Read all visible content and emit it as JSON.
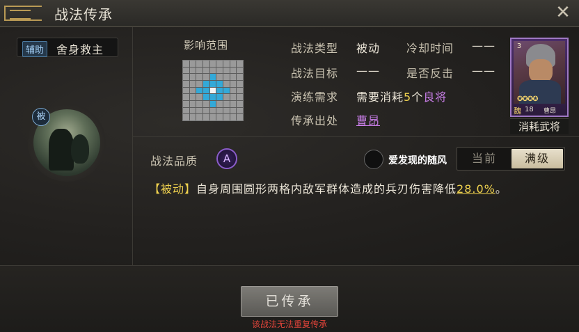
{
  "window": {
    "title": "战法传承",
    "close_label": "✕"
  },
  "skill": {
    "type_tag": "辅助",
    "name": "舍身救主",
    "passive_badge": "被"
  },
  "range": {
    "label": "影响范围",
    "grid_size": 9,
    "hit_cells": [
      [
        3,
        4
      ],
      [
        4,
        3
      ],
      [
        4,
        5
      ],
      [
        5,
        4
      ],
      [
        2,
        4
      ],
      [
        4,
        2
      ],
      [
        4,
        6
      ],
      [
        6,
        4
      ],
      [
        3,
        3
      ],
      [
        3,
        5
      ],
      [
        5,
        3
      ],
      [
        5,
        5
      ]
    ],
    "self_cell": [
      4,
      4
    ]
  },
  "info": {
    "type_label": "战法类型",
    "type_value": "被动",
    "cooldown_label": "冷却时间",
    "cooldown_value": "——",
    "target_label": "战法目标",
    "target_value": "——",
    "counter_label": "是否反击",
    "counter_value": "——",
    "train_label": "演练需求",
    "train_prefix": "需要消耗",
    "train_count": "5",
    "train_unit": "个",
    "train_item": "良将",
    "source_label": "传承出处",
    "source_value": "曹昂"
  },
  "general": {
    "cost": "3",
    "stars": "✪✪✪✪",
    "faction": "魏",
    "level": "18",
    "name": "曹昂",
    "consume_label": "消耗武将"
  },
  "quality": {
    "label": "战法品质",
    "grade": "A"
  },
  "watermark": {
    "text": "爱发现的随风"
  },
  "level_toggle": {
    "current": "当前",
    "max": "满级"
  },
  "description": {
    "tag": "【被动】",
    "text_before": "自身周围圆形两格内敌军群体造成的兵刃伤害降低",
    "value": "28.0%",
    "text_after": "。"
  },
  "action": {
    "button_label": "已传承",
    "note": "该战法无法重复传承"
  }
}
